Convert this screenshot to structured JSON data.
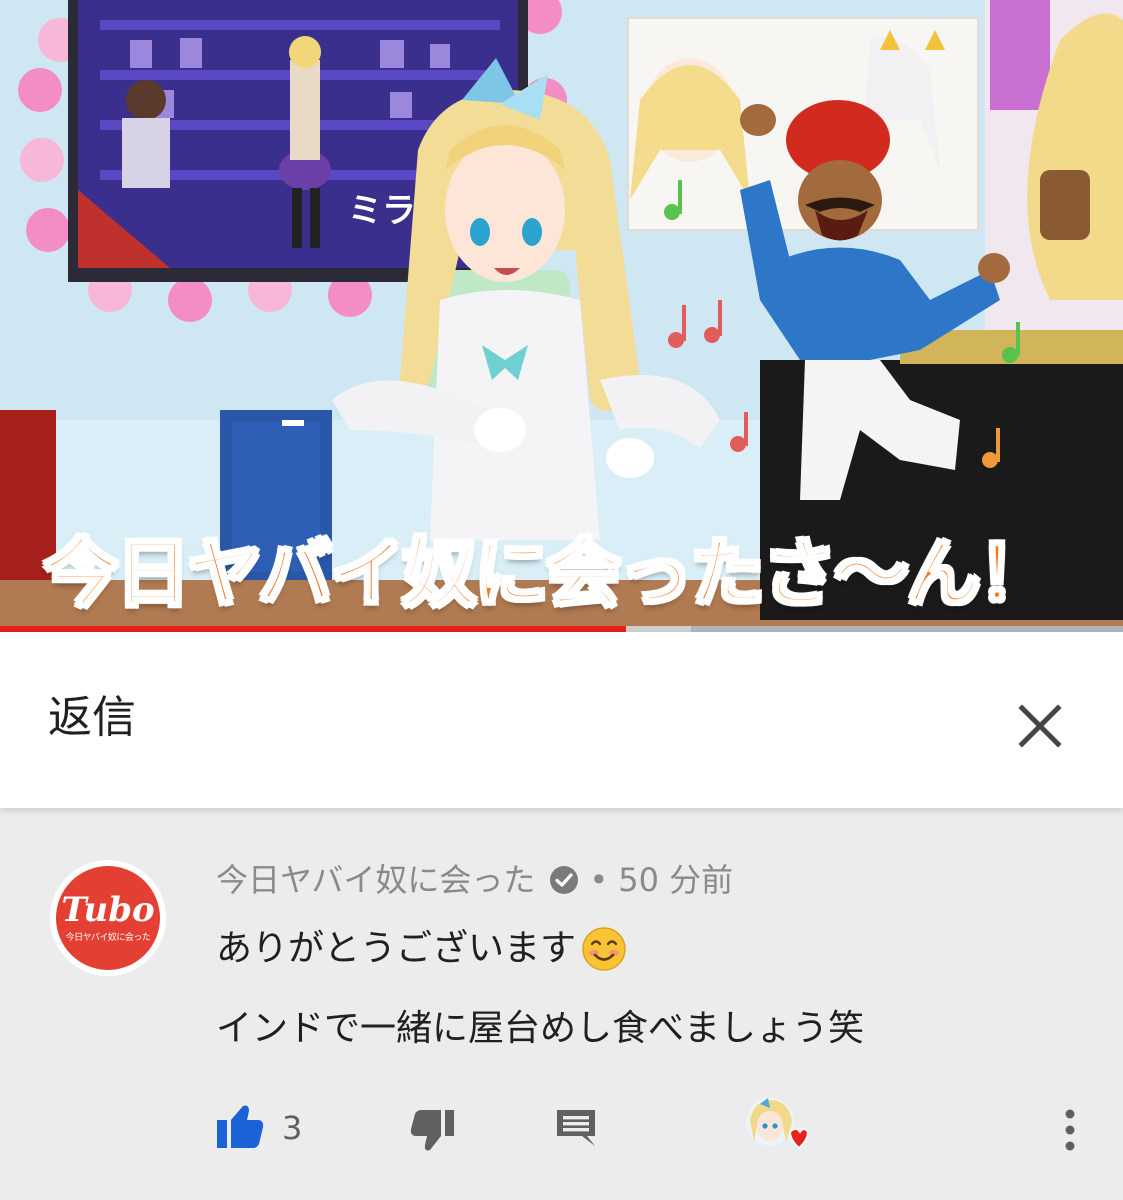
{
  "video": {
    "caption": "今日ヤバイ奴に会ったさ〜ん！",
    "screen_text": "ミライア",
    "progress_fraction": 0.557,
    "buffered_fraction": 0.615,
    "colors": {
      "progress": "#e62117",
      "caption_fill": "#f07a28",
      "caption_outline": "#ffffff"
    }
  },
  "reply_header": {
    "title": "返信",
    "close_icon": "close-icon"
  },
  "comment": {
    "avatar": {
      "wordmark": "Tubo",
      "subtitle": "今日ヤバイ奴に会った",
      "color": "#e43f33"
    },
    "author": "今日ヤバイ奴に会った",
    "verified_icon": "verified-check-icon",
    "separator": "•",
    "time": "50 分前",
    "lines": [
      "ありがとうございます",
      "インドで一緒に屋台めし食べましょう笑"
    ],
    "emoji_icon": "smiling-face-emoji-icon",
    "actions": {
      "like_icon": "thumbs-up-icon",
      "like_count": "3",
      "like_color": "#1a62d6",
      "dislike_icon": "thumbs-down-icon",
      "reply_icon": "reply-comment-icon",
      "creator_heart_icon": "creator-heart-icon",
      "more_icon": "more-vertical-icon"
    }
  }
}
